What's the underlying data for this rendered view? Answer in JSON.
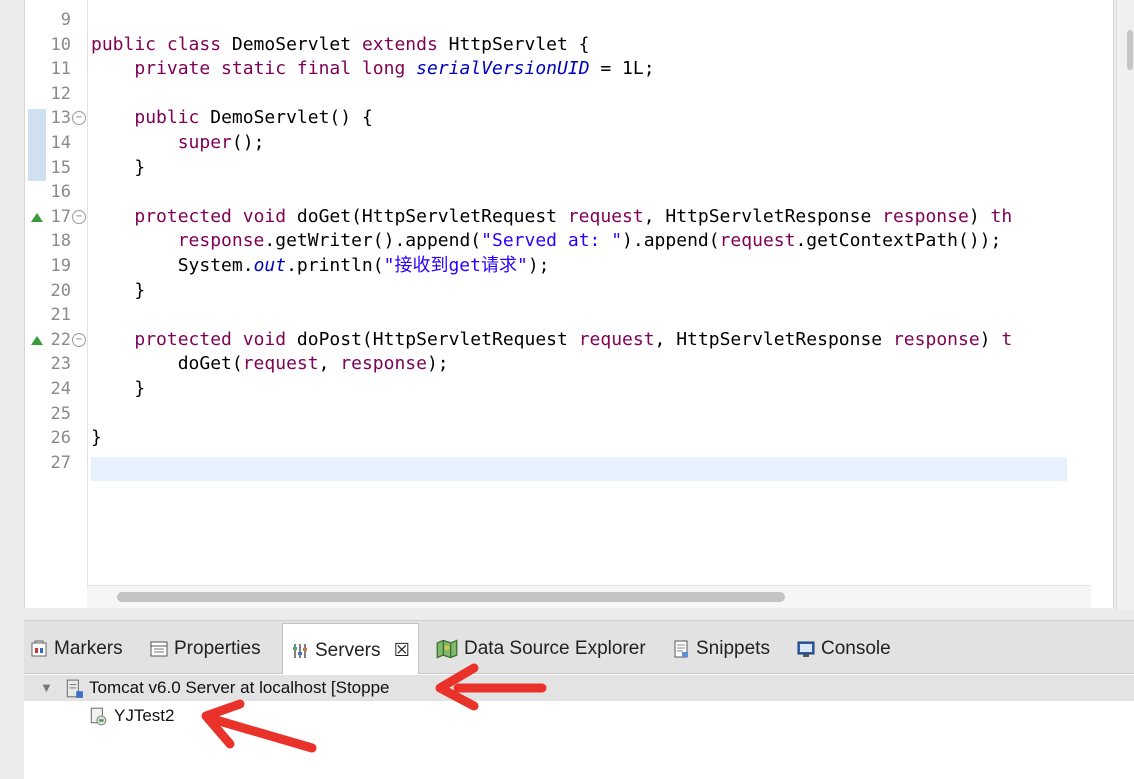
{
  "editor": {
    "lines": [
      {
        "num": "9",
        "html": ""
      },
      {
        "num": "10",
        "html": "<span class=\"kw\">public class</span> DemoServlet <span class=\"kw\">extends</span> HttpServlet {"
      },
      {
        "num": "11",
        "html": "    <span class=\"kw\">private static final long</span> <span class=\"field\">serialVersionUID</span> = 1L;"
      },
      {
        "num": "12",
        "html": ""
      },
      {
        "num": "13",
        "html": "    <span class=\"kw\">public</span> DemoServlet() {"
      },
      {
        "num": "14",
        "html": "        <span class=\"kw\">super</span>();"
      },
      {
        "num": "15",
        "html": "    }"
      },
      {
        "num": "16",
        "html": ""
      },
      {
        "num": "17",
        "html": "    <span class=\"kw\">protected void</span> doGet(HttpServletRequest <span class=\"kw\">request</span>, HttpServletResponse <span class=\"kw\">response</span>) <span class=\"kw\">th</span>"
      },
      {
        "num": "18",
        "html": "        <span class=\"kw\">response</span>.getWriter().append(<span class=\"str\">\"Served at: \"</span>).append(<span class=\"kw\">request</span>.getContextPath());"
      },
      {
        "num": "19",
        "html": "        System.<span class=\"field\">out</span>.println(<span class=\"str\">\"接收到get请求\"</span>);"
      },
      {
        "num": "20",
        "html": "    }"
      },
      {
        "num": "21",
        "html": ""
      },
      {
        "num": "22",
        "html": "    <span class=\"kw\">protected void</span> doPost(HttpServletRequest <span class=\"kw\">request</span>, HttpServletResponse <span class=\"kw\">response</span>) <span class=\"kw\">t</span>"
      },
      {
        "num": "23",
        "html": "        doGet(<span class=\"kw\">request</span>, <span class=\"kw\">response</span>);"
      },
      {
        "num": "24",
        "html": "    }"
      },
      {
        "num": "25",
        "html": ""
      },
      {
        "num": "26",
        "html": "}"
      },
      {
        "num": "27",
        "html": ""
      }
    ],
    "fold_markers": [
      "13",
      "17",
      "22"
    ],
    "override_markers": [
      "17",
      "22"
    ]
  },
  "panel": {
    "tabs": [
      {
        "id": "markers",
        "label": "Markers",
        "icon": "markers-icon"
      },
      {
        "id": "properties",
        "label": "Properties",
        "icon": "properties-icon"
      },
      {
        "id": "servers",
        "label": "Servers",
        "icon": "servers-icon",
        "active": true,
        "close": "☒"
      },
      {
        "id": "datasource",
        "label": "Data Source Explorer",
        "icon": "data-source-icon"
      },
      {
        "id": "snippets",
        "label": "Snippets",
        "icon": "snippets-icon"
      },
      {
        "id": "console",
        "label": "Console",
        "icon": "console-icon"
      }
    ],
    "servers": {
      "server_label": "Tomcat v6.0 Server at localhost  [Stoppe",
      "project_label": "YJTest2"
    }
  },
  "colors": {
    "annotation_arrow": "#e8322a",
    "keyword": "#7f0055",
    "string": "#2a00ff",
    "field": "#0000c0"
  }
}
